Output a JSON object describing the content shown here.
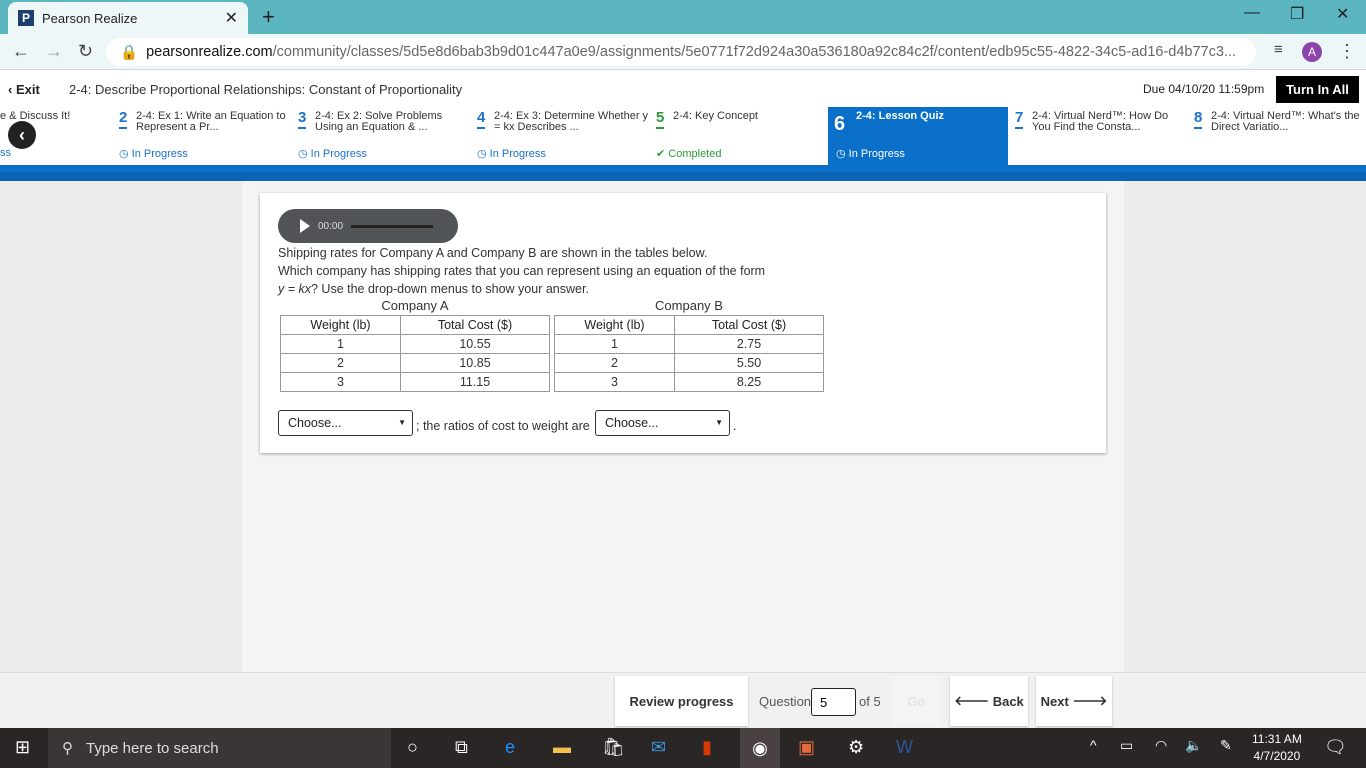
{
  "browser": {
    "tab_title": "Pearson Realize",
    "favicon": "P",
    "url_host": "pearsonrealize.com",
    "url_path": "/community/classes/5d5e8d6bab3b9d01c447a0e9/assignments/5e0771f72d924a30a536180a92c84c2f/content/edb95c55-4822-34c5-ad16-d4b77c3...",
    "avatar": "A"
  },
  "header": {
    "exit": "Exit",
    "title": "2-4: Describe Proportional Relationships: Constant of Proportionality",
    "due": "Due 04/10/20 11:59pm",
    "turn_in": "Turn In All"
  },
  "steps": [
    {
      "num": "",
      "label": "e & Discuss It!",
      "status": "ss"
    },
    {
      "num": "2",
      "label": "2-4: Ex 1: Write an Equation to Represent a Pr...",
      "status": "In Progress"
    },
    {
      "num": "3",
      "label": "2-4: Ex 2: Solve Problems Using an Equation & ...",
      "status": "In Progress"
    },
    {
      "num": "4",
      "label": "2-4: Ex 3: Determine Whether y = kx Describes ...",
      "status": "In Progress"
    },
    {
      "num": "5",
      "label": "2-4: Key Concept",
      "status": "Completed"
    },
    {
      "num": "6",
      "label": "2-4: Lesson Quiz",
      "status": "In Progress"
    },
    {
      "num": "7",
      "label": "2-4: Virtual Nerd™: How Do You Find the Consta...",
      "status": ""
    },
    {
      "num": "8",
      "label": "2-4: Virtual Nerd™: What's the Direct Variatio...",
      "status": ""
    }
  ],
  "question": {
    "audio_time": "00:00",
    "line1": "Shipping rates for Company A and Company B are shown in the tables below.",
    "line2": "Which company has shipping rates that you can represent using an equation of the form",
    "line3_eq": "y = kx",
    "line3_rest": "? Use the drop-down menus to show your answer.",
    "tables": [
      {
        "caption": "Company A",
        "headers": [
          "Weight (lb)",
          "Total Cost ($)"
        ],
        "rows": [
          [
            "1",
            "10.55"
          ],
          [
            "2",
            "10.85"
          ],
          [
            "3",
            "11.15"
          ]
        ]
      },
      {
        "caption": "Company B",
        "headers": [
          "Weight (lb)",
          "Total Cost ($)"
        ],
        "rows": [
          [
            "1",
            "2.75"
          ],
          [
            "2",
            "5.50"
          ],
          [
            "3",
            "8.25"
          ]
        ]
      }
    ],
    "select1": "Choose...",
    "ratio_text": "; the ratios of cost to weight are",
    "select2": "Choose...",
    "period": "."
  },
  "footer": {
    "review": "Review progress",
    "question_label": "Question",
    "question_value": "5",
    "of": "of 5",
    "go": "Go",
    "back": "Back",
    "next": "Next"
  },
  "taskbar": {
    "search_placeholder": "Type here to search",
    "time": "11:31 AM",
    "date": "4/7/2020"
  }
}
